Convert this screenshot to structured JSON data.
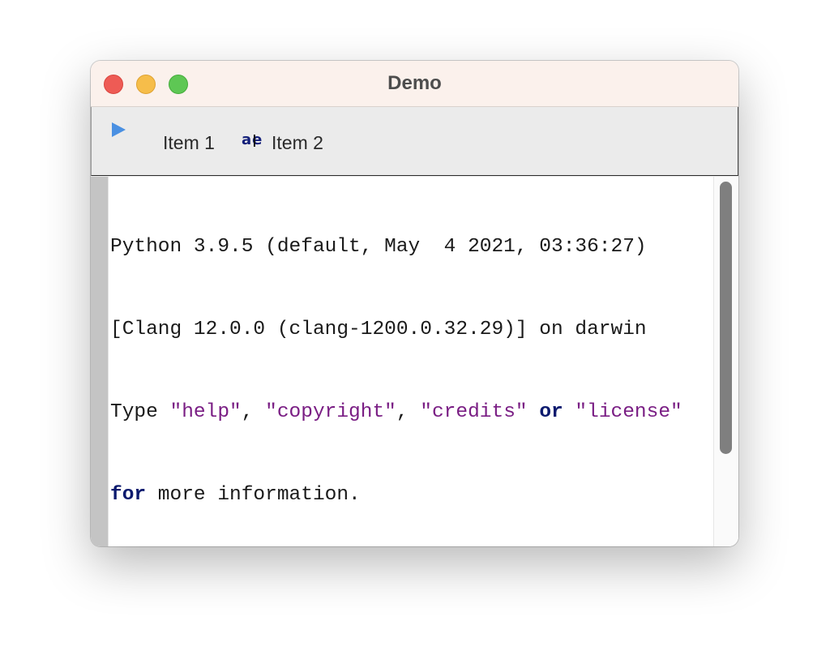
{
  "window": {
    "title": "Demo"
  },
  "toolbar": {
    "item1_label": "Item 1",
    "item2_label": "Item 2",
    "ae_icon_text": "ae",
    "play_color": "#4a90e2"
  },
  "console": {
    "line1": "Python 3.9.5 (default, May  4 2021, 03:36:27)",
    "line2": "[Clang 12.0.0 (clang-1200.0.32.29)] on darwin",
    "line3": {
      "t1": "Type ",
      "s1": "\"help\"",
      "t2": ", ",
      "s2": "\"copyright\"",
      "t3": ", ",
      "s3": "\"credits\"",
      "t4": " ",
      "k1": "or",
      "t5": " ",
      "s4": "\"license\""
    },
    "line4": {
      "k1": "for",
      "t1": " more information."
    },
    "prompt": ">>> "
  },
  "colors": {
    "string": "#7a1e84",
    "keyword": "#0b1a6e",
    "titlebar": "#fbf1ec"
  }
}
